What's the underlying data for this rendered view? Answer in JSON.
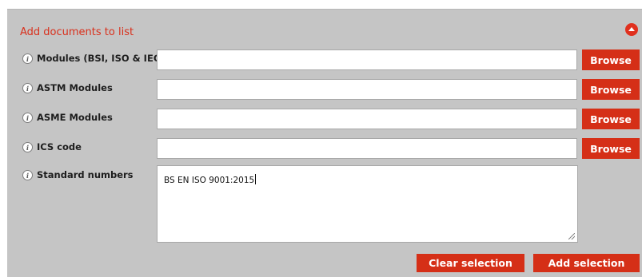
{
  "panel": {
    "title": "Add documents to list",
    "collapse_icon": "collapse-up-icon"
  },
  "rows": [
    {
      "label": "Modules (BSI, ISO & IEC)",
      "value": "",
      "button": "Browse"
    },
    {
      "label": "ASTM Modules",
      "value": "",
      "button": "Browse"
    },
    {
      "label": "ASME Modules",
      "value": "",
      "button": "Browse"
    },
    {
      "label": "ICS code",
      "value": "",
      "button": "Browse"
    }
  ],
  "standard_numbers": {
    "label": "Standard numbers",
    "value": "BS EN ISO 9001:2015"
  },
  "info_icon": "i",
  "actions": {
    "clear_label": "Clear selection",
    "add_label": "Add selection"
  },
  "colors": {
    "accent": "#d52f17",
    "title": "#d9301c",
    "panel_bg": "#c5c5c5"
  }
}
